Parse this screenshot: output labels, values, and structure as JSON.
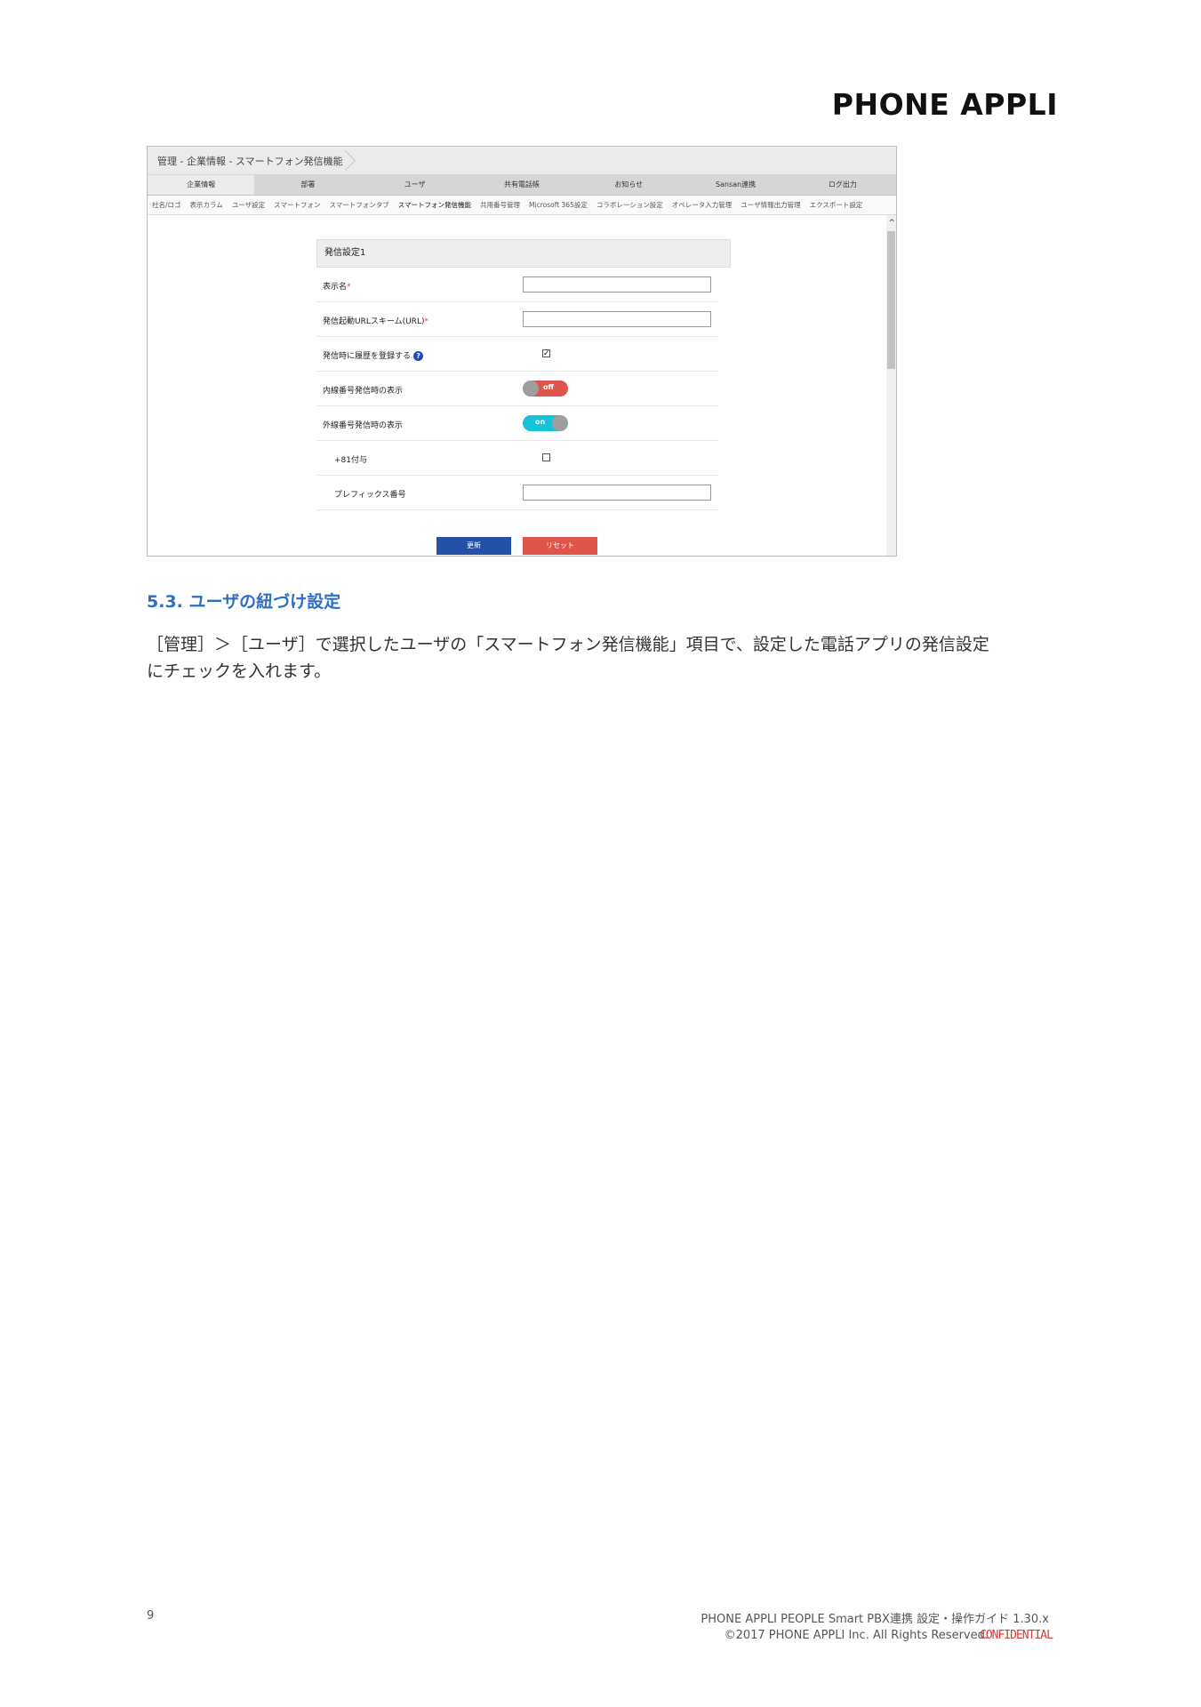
{
  "header": {
    "brand": "PHONE APPLI"
  },
  "screenshot": {
    "breadcrumb": "管理 - 企業情報 - スマートフォン発信機能",
    "tabs": [
      "企業情報",
      "部署",
      "ユーザ",
      "共有電話帳",
      "お知らせ",
      "Sansan連携",
      "ログ出力"
    ],
    "active_tab": "企業情報",
    "subtabs": [
      "社名/ロゴ",
      "表示カラム",
      "ユーザ設定",
      "スマートフォン",
      "スマートフォンタブ",
      "スマートフォン発信機能",
      "共用番号管理",
      "Microsoft 365設定",
      "コラボレーション設定",
      "オペレータ入力管理",
      "ユーザ情報出力管理",
      "エクスポート設定"
    ],
    "active_subtab": "スマートフォン発信機能",
    "panel_title": "発信設定1",
    "fields": {
      "display_name": {
        "label": "表示名",
        "required": "*",
        "value": ""
      },
      "url_scheme": {
        "label": "発信起動URLスキーム(URL)",
        "required": "*",
        "value": ""
      },
      "history": {
        "label": "発信時に履歴を登録する",
        "help": "?",
        "checked": true,
        "check_mark": "✓"
      },
      "internal_display": {
        "label": "内線番号発信時の表示",
        "toggle": "off"
      },
      "external_display": {
        "label": "外線番号発信時の表示",
        "toggle": "on"
      },
      "plus81": {
        "label": "+81付与",
        "checked": false
      },
      "prefix": {
        "label": "プレフィックス番号",
        "value": ""
      }
    },
    "buttons": {
      "update": "更新",
      "reset": "リセット"
    },
    "scroll_up_icon": "^"
  },
  "section": {
    "title": "5.3. ユーザの紐づけ設定",
    "body_line1": "［管理］＞［ユーザ］で選択したユーザの「スマートフォン発信機能」項目で、設定した電話アプリの発信設定",
    "body_line2": "にチェックを入れます。"
  },
  "footer": {
    "page_number": "9",
    "doc_title": "PHONE APPLI PEOPLE Smart PBX連携 設定・操作ガイド 1.30.x",
    "copyright": "©2017 PHONE APPLI Inc. All Rights Reserved.",
    "confidential": "CONFIDENTIAL"
  },
  "colors": {
    "accent_blue": "#2e6fc2",
    "update_button": "#2450a8",
    "reset_button": "#e0544b",
    "toggle_on": "#15c2d9",
    "toggle_off": "#e0544b"
  }
}
